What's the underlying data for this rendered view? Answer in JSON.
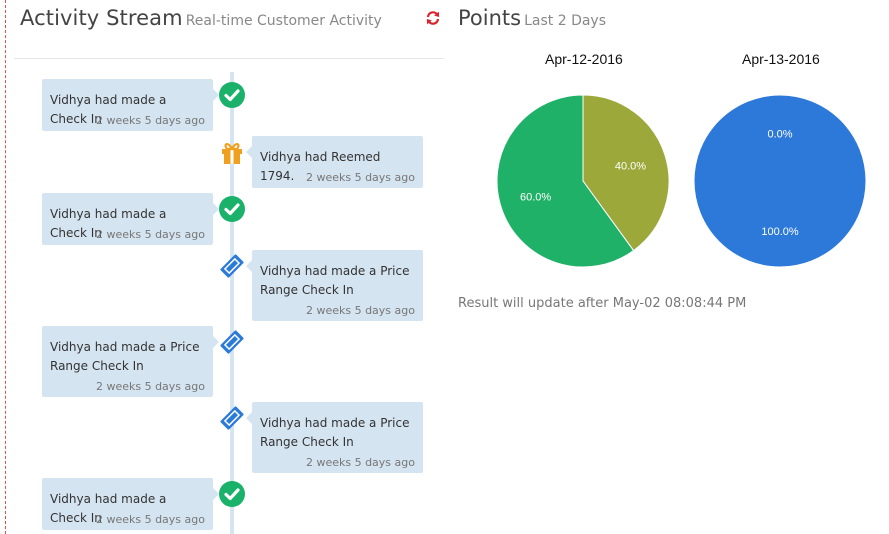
{
  "activity": {
    "title": "Activity Stream",
    "subtitle": "Real-time Customer Activity",
    "items": [
      {
        "text": "Vidhya had made a Check In",
        "time": "2 weeks 5 days ago",
        "icon": "check-circle-icon"
      },
      {
        "text": "Vidhya had Reemed 1794.",
        "time": "2 weeks 5 days ago",
        "icon": "gift-icon"
      },
      {
        "text": "Vidhya had made a Check In",
        "time": "2 weeks 5 days ago",
        "icon": "check-circle-icon"
      },
      {
        "text": "Vidhya had made a Price Range Check In",
        "time": "2 weeks 5 days ago",
        "icon": "ticket-icon"
      },
      {
        "text": "Vidhya had made a Price Range Check In",
        "time": "2 weeks 5 days ago",
        "icon": "ticket-icon"
      },
      {
        "text": "Vidhya had made a Price Range Check In",
        "time": "2 weeks 5 days ago",
        "icon": "ticket-icon"
      },
      {
        "text": "Vidhya had made a Check In",
        "time": "2 weeks 5 days ago",
        "icon": "check-circle-icon"
      }
    ]
  },
  "points": {
    "title": "Points",
    "subtitle": "Last 2 Days",
    "update_note": "Result will update after May-02 08:08:44 PM"
  },
  "colors": {
    "check": "#1ab16a",
    "gift": "#f0a020",
    "ticket": "#2a7ad8",
    "refresh": "#d9232d",
    "pie_green": "#1eb167",
    "pie_olive": "#9ca83a",
    "pie_blue": "#2d79d9"
  },
  "chart_data": [
    {
      "type": "pie",
      "title": "Apr-12-2016",
      "slices": [
        {
          "value": 40.0,
          "label": "40.0%",
          "color": "#9ca83a"
        },
        {
          "value": 60.0,
          "label": "60.0%",
          "color": "#1eb167"
        }
      ]
    },
    {
      "type": "pie",
      "title": "Apr-13-2016",
      "slices": [
        {
          "value": 0.0,
          "label": "0.0%",
          "color": "#ffffff"
        },
        {
          "value": 100.0,
          "label": "100.0%",
          "color": "#2d79d9"
        }
      ]
    }
  ]
}
